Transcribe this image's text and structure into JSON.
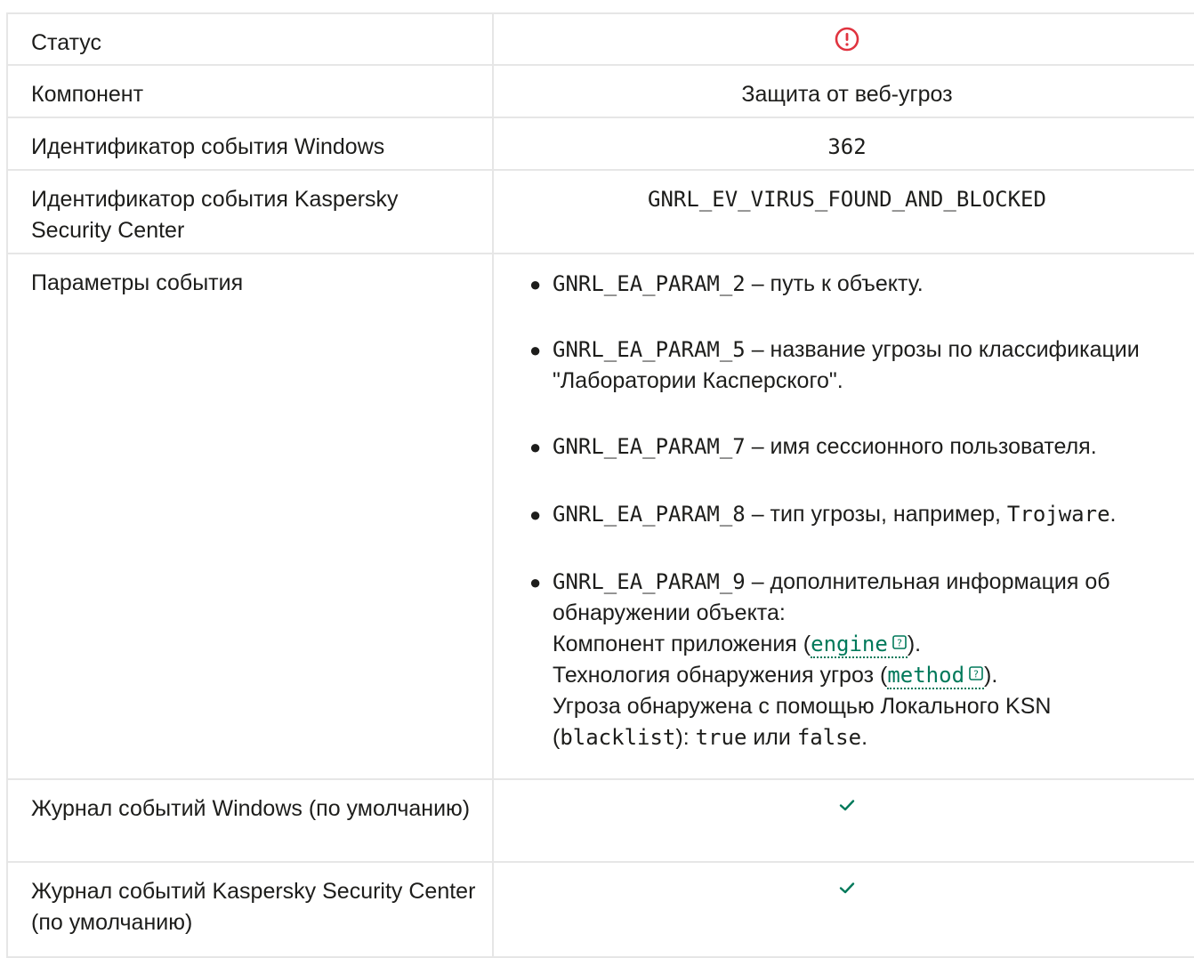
{
  "table": {
    "status_label": "Статус",
    "status_icon": "error-circle-icon",
    "component_label": "Компонент",
    "component_value": "Защита от веб-угроз",
    "windows_id_label": "Идентификатор события Windows",
    "windows_id_value": "362",
    "ksc_id_label": "Идентификатор события Kaspersky Security Center",
    "ksc_id_value": "GNRL_EV_VIRUS_FOUND_AND_BLOCKED",
    "params_label": "Параметры события",
    "params": [
      {
        "code": "GNRL_EA_PARAM_2",
        "text": " – путь к объекту."
      },
      {
        "code": "GNRL_EA_PARAM_5",
        "text": " – название угрозы по классификации \"Лаборатории Касперского\"."
      },
      {
        "code": "GNRL_EA_PARAM_7",
        "text": " – имя сессионного пользователя."
      },
      {
        "code": "GNRL_EA_PARAM_8",
        "text": " – тип угрозы, например, ",
        "code2": "Trojware",
        "tail": "."
      },
      {
        "code": "GNRL_EA_PARAM_9",
        "text": " – дополнительная информация об обнаружении объекта:",
        "line2_prefix": "Компонент приложения (",
        "line2_link": "engine",
        "line2_suffix": ").",
        "line3_prefix": "Технология обнаружения угроз (",
        "line3_link": "method",
        "line3_suffix": ").",
        "line4": "Угроза обнаружена с помощью Локального KSN",
        "line5_open": "(",
        "line5_code1": "blacklist",
        "line5_mid": "): ",
        "line5_code2": "true",
        "line5_or": " или ",
        "line5_code3": "false",
        "line5_end": "."
      }
    ],
    "win_log_label": "Журнал событий Windows (по умолчанию)",
    "ksc_log_label": "Журнал событий Kaspersky Security Center (по умолчанию)",
    "check_icon": "checkmark-icon",
    "colors": {
      "status": "#e0333f",
      "check": "#00795a",
      "link": "#00795a",
      "border": "#e6e6e6"
    }
  }
}
